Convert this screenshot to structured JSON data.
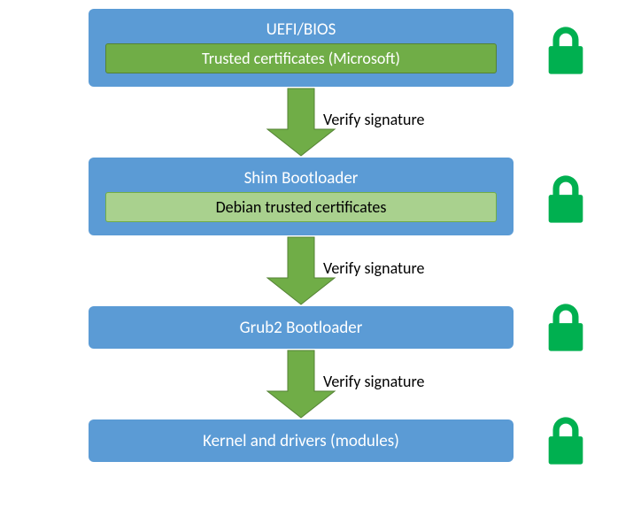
{
  "stages": [
    {
      "title": "UEFI/BIOS",
      "inner": "Trusted certificates (Microsoft)",
      "innerStyle": "dark"
    },
    {
      "title": "Shim Bootloader",
      "inner": "Debian trusted certificates",
      "innerStyle": "light"
    },
    {
      "title": "Grub2 Bootloader"
    },
    {
      "title": "Kernel and drivers (modules)"
    }
  ],
  "arrows": [
    {
      "label": "Verify signature"
    },
    {
      "label": "Verify signature"
    },
    {
      "label": "Verify signature"
    }
  ]
}
